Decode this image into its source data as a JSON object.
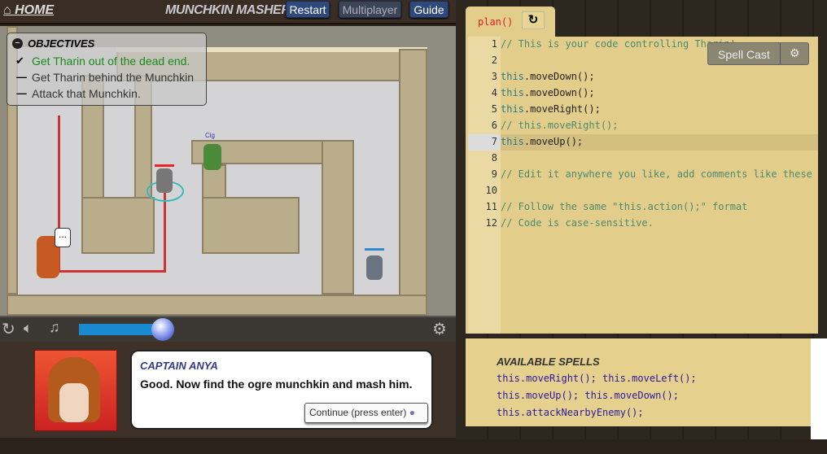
{
  "header": {
    "home": "HOME",
    "title": "MUNCHKIN MASHER",
    "buttons": [
      "Restart",
      "Multiplayer",
      "Guide"
    ]
  },
  "objectives": {
    "title": "OBJECTIVES",
    "items": [
      {
        "text": "Get Tharin out of the dead end.",
        "status": "done"
      },
      {
        "text": "Get Tharin behind the Munchkin",
        "status": "pending"
      },
      {
        "text": "Attack that Munchkin.",
        "status": "pending"
      }
    ]
  },
  "map": {
    "speech": "...",
    "enemy_label": "Cig"
  },
  "playback": {
    "progress_percent": 100
  },
  "dialog": {
    "speaker": "CAPTAIN ANYA",
    "message": "Good. Now find the ogre munchkin and mash him.",
    "continue": "Continue (press enter)"
  },
  "editor": {
    "tab": "plan()",
    "spell_cast": "Spell Cast",
    "lines": [
      {
        "n": "1",
        "text": "// This is your code controlling Tharin!",
        "type": "cm"
      },
      {
        "n": "2",
        "text": "",
        "type": "cm"
      },
      {
        "n": "3",
        "text": "this.moveDown();",
        "type": "code"
      },
      {
        "n": "4",
        "text": "this.moveDown();",
        "type": "code"
      },
      {
        "n": "5",
        "text": "this.moveRight();",
        "type": "code"
      },
      {
        "n": "6",
        "text": "// this.moveRight();",
        "type": "cm"
      },
      {
        "n": "7",
        "text": "this.moveUp();",
        "type": "code"
      },
      {
        "n": "8",
        "text": "",
        "type": "cm"
      },
      {
        "n": "9",
        "text": "// Edit it anywhere you like, add comments like these",
        "type": "cm"
      },
      {
        "n": "10",
        "text": "",
        "type": "cm"
      },
      {
        "n": "11",
        "text": "// Follow the same \"this.action();\" format",
        "type": "cm"
      },
      {
        "n": "12",
        "text": "// Code is case-sensitive.",
        "type": "cm"
      }
    ]
  },
  "spells": {
    "title": "AVAILABLE SPELLS",
    "lines": [
      "this.moveRight(); this.moveLeft();",
      "this.moveUp(); this.moveDown();",
      "this.attackNearbyEnemy();"
    ]
  }
}
